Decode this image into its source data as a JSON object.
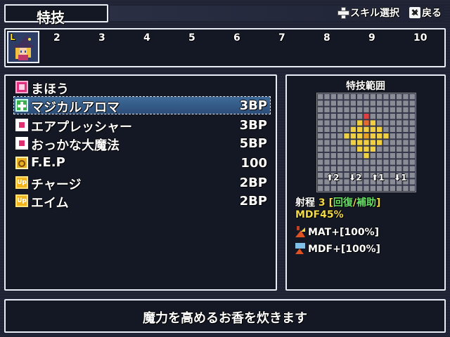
{
  "header": {
    "title": "特技",
    "hint_skill_select": "スキル選択",
    "hint_back": "戻る"
  },
  "party": {
    "active_level_mark": "L",
    "slot_numbers": [
      "2",
      "3",
      "4",
      "5",
      "6",
      "7",
      "8",
      "9",
      "10"
    ]
  },
  "skills": [
    {
      "icon": "magic-category-icon",
      "name": "まほう",
      "cost": ""
    },
    {
      "icon": "heal-cross-icon",
      "name": "マジカルアロマ",
      "cost": "3BP"
    },
    {
      "icon": "pink-square-icon",
      "name": "エアプレッシャー",
      "cost": "3BP"
    },
    {
      "icon": "pink-square-icon",
      "name": "おっかな大魔法",
      "cost": "5BP"
    },
    {
      "icon": "fep-icon",
      "name": "F.E.P",
      "cost": "100"
    },
    {
      "icon": "buff-icon",
      "name": "チャージ",
      "cost": "2BP"
    },
    {
      "icon": "buff-icon",
      "name": "エイム",
      "cost": "2BP"
    }
  ],
  "selected_skill_index": 1,
  "buff_icon_text": "Up",
  "range": {
    "title": "特技範囲",
    "modifiers": [
      "2",
      "2",
      "1",
      "1"
    ],
    "range_label": "射程",
    "range_value": "3",
    "category_open": "[",
    "category_heal": "回復",
    "category_sep": "/",
    "category_support": "補助",
    "category_close": "]",
    "mdf_line": "MDF45%",
    "effects": [
      "MAT+[100%]",
      "MDF+[100%]"
    ]
  },
  "help_text": "魔力を高めるお香を炊きます",
  "colors": {
    "window_border": "#e8ecf4",
    "window_bg": "#141824",
    "selection": "#3e6a98",
    "accent_yellow": "#f0d848",
    "accent_green": "#68e068"
  }
}
